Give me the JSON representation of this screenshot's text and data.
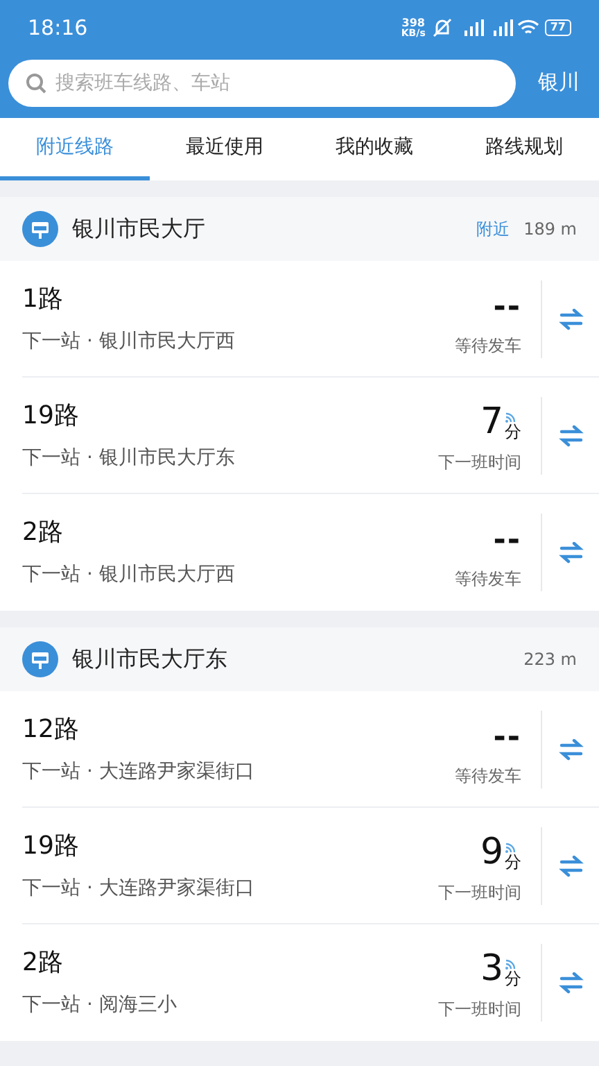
{
  "status_bar": {
    "time": "18:16",
    "net_speed": "398",
    "net_unit": "KB/s",
    "battery": "77"
  },
  "search": {
    "placeholder": "搜索班车线路、车站",
    "city": "银川"
  },
  "tabs": [
    {
      "label": "附近线路",
      "selected": true
    },
    {
      "label": "最近使用",
      "selected": false
    },
    {
      "label": "我的收藏",
      "selected": false
    },
    {
      "label": "路线规划",
      "selected": false
    }
  ],
  "stations": [
    {
      "name": "银川市民大厅",
      "nearby_tag": "附近",
      "distance": "189 m",
      "routes": [
        {
          "kind": "waiting",
          "name": "1路",
          "next_stop": "下一站 · 银川市民大厅西",
          "time": "--",
          "status": "等待发车"
        },
        {
          "kind": "realtime",
          "name": "19路",
          "next_stop": "下一站 · 银川市民大厅东",
          "time": "7",
          "unit": "分",
          "status": "下一班时间"
        },
        {
          "kind": "waiting",
          "name": "2路",
          "next_stop": "下一站 · 银川市民大厅西",
          "time": "--",
          "status": "等待发车"
        }
      ]
    },
    {
      "name": "银川市民大厅东",
      "distance": "223 m",
      "routes": [
        {
          "kind": "waiting",
          "name": "12路",
          "next_stop": "下一站 · 大连路尹家渠街口",
          "time": "--",
          "status": "等待发车"
        },
        {
          "kind": "realtime",
          "name": "19路",
          "next_stop": "下一站 · 大连路尹家渠街口",
          "time": "9",
          "unit": "分",
          "status": "下一班时间"
        },
        {
          "kind": "realtime",
          "name": "2路",
          "next_stop": "下一站 · 阅海三小",
          "time": "3",
          "unit": "分",
          "status": "下一班时间"
        }
      ]
    }
  ]
}
